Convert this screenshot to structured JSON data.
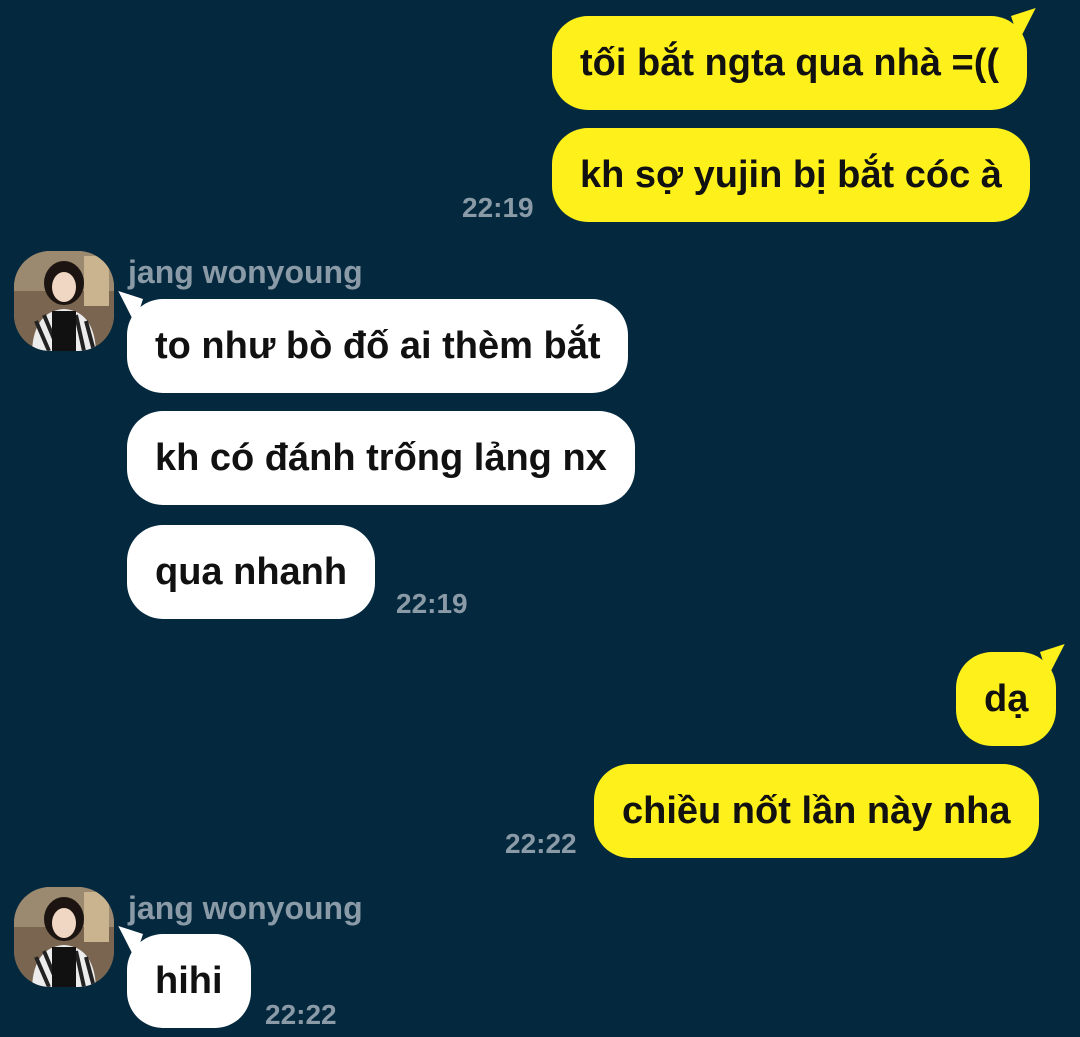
{
  "theme": {
    "background": "#04293f",
    "sent_bubble": "#fef01b",
    "received_bubble": "#ffffff",
    "meta_text": "#8a9aa6"
  },
  "messages": {
    "m1": "tối bắt ngta qua nhà =((",
    "m2": "kh sợ yujin bị bắt cóc à",
    "t1": "22:19",
    "g1_sender": "jang wonyoung",
    "m3": "to như bò đố ai thèm bắt",
    "m4": "kh có đánh trống lảng nx",
    "m5": "qua nhanh",
    "t2": "22:19",
    "m6": "dạ",
    "m7": "chiều nốt lần này nha",
    "t3": "22:22",
    "g2_sender": "jang wonyoung",
    "m8": "hihi",
    "t4": "22:22"
  },
  "avatar_icon": "profile-photo"
}
